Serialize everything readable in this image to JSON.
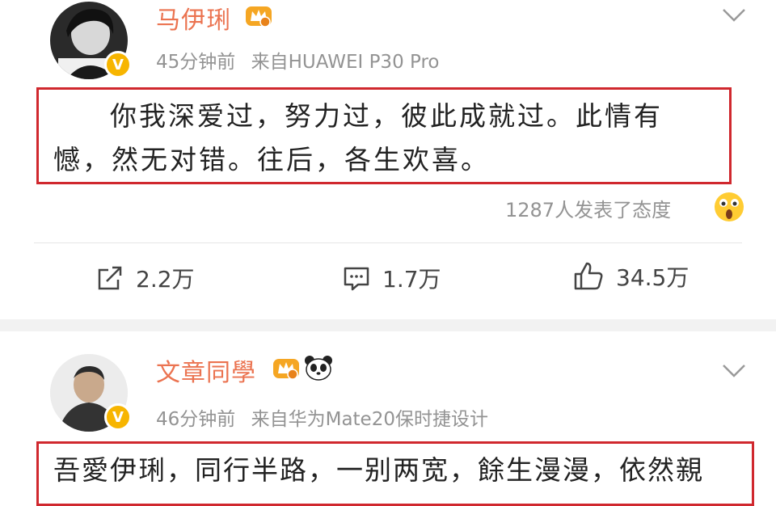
{
  "posts": [
    {
      "author": "马伊琍",
      "time": "45分钟前",
      "source": "来自HUAWEI P30 Pro",
      "text": "你我深爱过，努力过，彼此成就过。此情有憾，然无对错。往后，各生欢喜。",
      "reactions": "1287人发表了态度",
      "actions": {
        "repost": "2.2万",
        "comment": "1.7万",
        "like": "34.5万"
      },
      "icons": {
        "badge": "verified-v-icon",
        "vip": "vip-crown-icon",
        "reaction": "surprised-emoji-icon"
      }
    },
    {
      "author": "文章同學",
      "time": "46分钟前",
      "source": "来自华为Mate20保时捷设计",
      "text": "吾愛伊琍，同行半路，一别两宽，餘生漫漫，依然親",
      "icons": {
        "badge": "verified-v-icon",
        "vip": "vip-crown-icon",
        "extra": "panda-icon"
      }
    }
  ],
  "colors": {
    "name": "#eb7350",
    "meta": "#939393",
    "highlight_border": "#d0282e",
    "badge": "#f7b500"
  }
}
